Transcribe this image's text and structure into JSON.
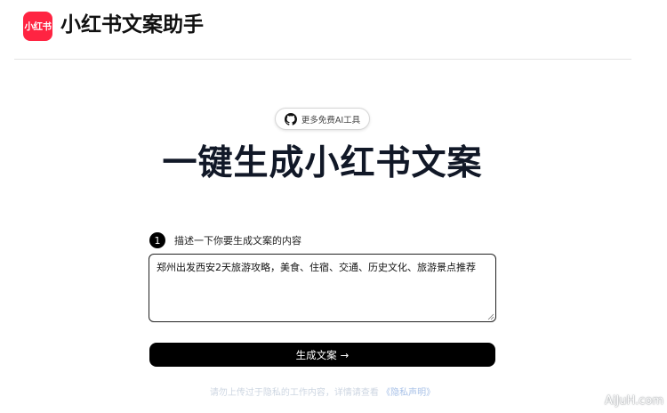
{
  "header": {
    "logo_text": "小红书",
    "title": "小红书文案助手"
  },
  "promo": {
    "label": "更多免费AI工具",
    "icon": "github-icon"
  },
  "hero": {
    "title": "一键生成小红书文案"
  },
  "step1": {
    "number": "1",
    "label": "描述一下你要生成文案的内容"
  },
  "input": {
    "value": "郑州出发西安2天旅游攻略，美食、住宿、交通、历史文化、旅游景点推荐"
  },
  "actions": {
    "generate_label": "生成文案",
    "generate_arrow": "→"
  },
  "footer": {
    "privacy_text": "请勿上传过于隐私的工作内容，详情请查看",
    "privacy_link": "《隐私声明》"
  },
  "watermark": "AiJuH.com",
  "colors": {
    "brand": "#ff2442",
    "primary_button": "#000000"
  }
}
